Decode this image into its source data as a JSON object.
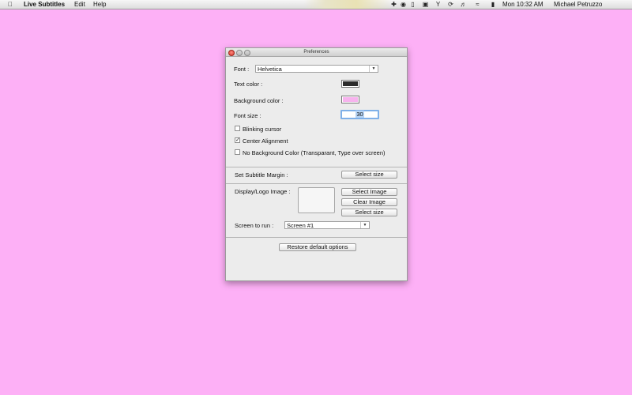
{
  "menubar": {
    "apple_icon": "apple-icon",
    "app_name": "Live Subtitles",
    "menus": [
      "Edit",
      "Help"
    ],
    "clock": "Mon 10:32 AM",
    "user": "Michael Petruzzo"
  },
  "window": {
    "title": "Preferences",
    "font_label": "Font :",
    "font_value": "Helvetica",
    "text_color_label": "Text color :",
    "text_color": "#2b2b2b",
    "bg_color_label": "Background color :",
    "bg_color": "#f7b3ee",
    "font_size_label": "Font size :",
    "font_size_value": "30",
    "options": [
      {
        "label": "Blinking cursor",
        "checked": false
      },
      {
        "label": "Center Alignment",
        "checked": true
      },
      {
        "label": "No Background Color (Transparant, Type over screen)",
        "checked": false
      }
    ],
    "margin_label": "Set Subtitle Margin :",
    "select_size_label": "Select size",
    "logo_label": "Display/Logo Image :",
    "select_image_label": "Select Image",
    "clear_image_label": "Clear Image",
    "screen_label": "Screen to run :",
    "screen_value": "Screen #1",
    "restore_label": "Restore default options"
  },
  "colors": {
    "desktop": "#fdb0f6"
  }
}
